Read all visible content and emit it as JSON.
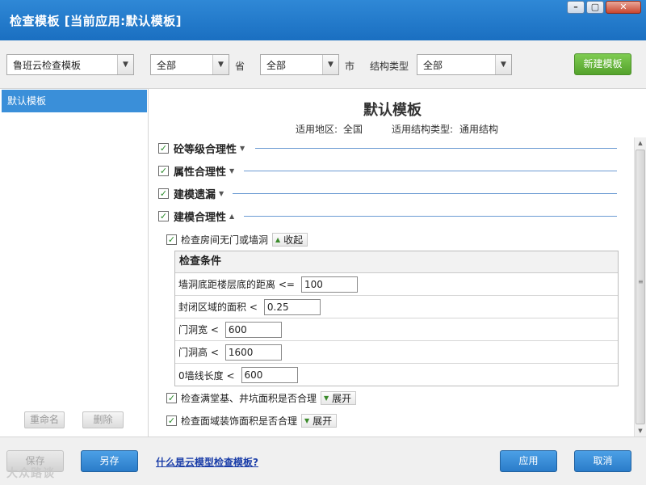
{
  "window": {
    "title": "检查模板 [当前应用:默认模板]",
    "min_glyph": "–",
    "max_glyph": "▢",
    "close_glyph": "✕"
  },
  "filters": {
    "template": "鲁班云检查模板",
    "province": "全部",
    "province_label": "省",
    "city": "全部",
    "city_label": "市",
    "structure_label": "结构类型",
    "structure": "全部",
    "new_button": "新建模板"
  },
  "left_panel": {
    "items": [
      {
        "label": "默认模板",
        "selected": true
      }
    ],
    "rename_button": "重命名",
    "delete_button": "删除"
  },
  "template": {
    "title": "默认模板",
    "region_label": "适用地区:",
    "region": "全国",
    "structure_label": "适用结构类型:",
    "structure": "通用结构"
  },
  "sections": [
    {
      "label": "砼等级合理性",
      "checked": true,
      "expanded": false
    },
    {
      "label": "属性合理性",
      "checked": true,
      "expanded": false
    },
    {
      "label": "建模遗漏",
      "checked": true,
      "expanded": false
    },
    {
      "label": "建模合理性",
      "checked": true,
      "expanded": true
    }
  ],
  "checks": [
    {
      "label": "检查房间无门或墙洞",
      "checked": true,
      "toggle": "收起"
    },
    {
      "label": "检查满堂基、井坑面积是否合理",
      "checked": true,
      "toggle": "展开"
    },
    {
      "label": "检查面域装饰面积是否合理",
      "checked": true,
      "toggle": "展开"
    }
  ],
  "conditions": {
    "header": "检查条件",
    "rows": [
      {
        "label": "墙洞底距楼层底的距离 <=",
        "value": "100"
      },
      {
        "label": "封闭区域的面积 <",
        "value": "0.25"
      },
      {
        "label": "门洞宽 <",
        "value": "600"
      },
      {
        "label": "门洞高 <",
        "value": "1600"
      },
      {
        "label": "0墙线长度 <",
        "value": "600"
      }
    ]
  },
  "footer": {
    "save": "保存",
    "save_as": "另存",
    "help_link": "什么是云模型检查模板?",
    "apply": "应用",
    "cancel": "取消",
    "watermark": "大众路谈"
  },
  "colors": {
    "titlebar": "#1a6fc1",
    "selected_item": "#3a8fd9",
    "green_button": "#54a22c",
    "blue_button": "#2a7cc9",
    "section_line": "#6c9bd3"
  }
}
